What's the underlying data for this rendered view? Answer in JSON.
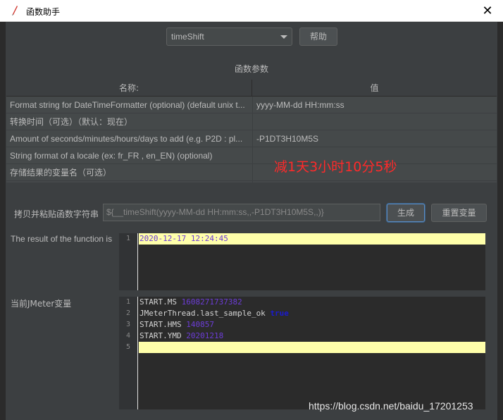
{
  "window": {
    "title": "函数助手",
    "close_glyph": "✕"
  },
  "toolbar": {
    "function_select": "timeShift",
    "help_label": "帮助"
  },
  "params": {
    "section_title": "函数参数",
    "headers": {
      "name": "名称:",
      "value": "值"
    },
    "rows": [
      {
        "name": "Format string for DateTimeFormatter (optional) (default unix t...",
        "value": "yyyy-MM-dd HH:mm:ss"
      },
      {
        "name": "转换时间（可选）（默认：现在）",
        "value": ""
      },
      {
        "name": "Amount of seconds/minutes/hours/days to add (e.g. P2D : pl...",
        "value": "-P1DT3H10M5S"
      },
      {
        "name": "String format of a locale (ex: fr_FR , en_EN) (optional)",
        "value": ""
      },
      {
        "name": "存储结果的变量名（可选）",
        "value": ""
      }
    ]
  },
  "annotation": "减1天3小时10分5秒",
  "copy": {
    "label": "拷贝并粘贴函数字符串",
    "value": "${__timeShift(yyyy-MM-dd HH:mm:ss,,-P1DT3H10M5S,,)}",
    "generate_label": "生成",
    "reset_label": "重置变量"
  },
  "result": {
    "label": "The result of the function is",
    "lines": [
      {
        "n": "1",
        "text": "2020-12-17 12:24:45"
      }
    ]
  },
  "jmeter_vars": {
    "label": "当前JMeter变量",
    "lines": [
      {
        "n": "1",
        "key": "START.MS",
        "val": "1608271737382",
        "type": "num"
      },
      {
        "n": "2",
        "key": "JMeterThread.last_sample_ok",
        "val": "true",
        "type": "kw"
      },
      {
        "n": "3",
        "key": "START.HMS",
        "val": "140857",
        "type": "num"
      },
      {
        "n": "4",
        "key": "START.YMD",
        "val": "20201218",
        "type": "num"
      },
      {
        "n": "5",
        "key": "",
        "val": "",
        "type": ""
      }
    ]
  },
  "watermark": "https://blog.csdn.net/baidu_17201253",
  "colors": {
    "background": "#3c3f41",
    "editor_bg": "#2b2b2b",
    "current_line": "#ffffaa",
    "annotation": "#ff2a2a",
    "number_token": "#6c3cd6",
    "keyword_token": "#1a1ad0"
  },
  "icons": {
    "app": "jmeter-feather-icon",
    "close": "close-icon",
    "dropdown": "chevron-down-icon"
  }
}
